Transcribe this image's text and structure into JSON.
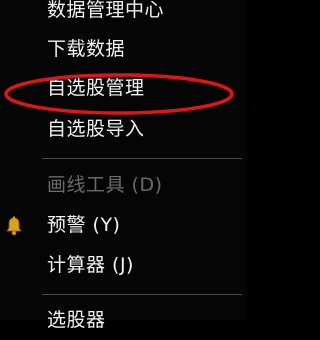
{
  "menu": {
    "items": [
      {
        "label": "数据管理中心"
      },
      {
        "label": "下载数据"
      },
      {
        "label": "自选股管理"
      },
      {
        "label": "自选股导入"
      },
      {
        "label": "画线工具 (D)"
      },
      {
        "label": "预警 (Y)"
      },
      {
        "label": "计算器 (J)"
      },
      {
        "label": "选股器"
      }
    ]
  },
  "colors": {
    "background": "#050505",
    "text": "#f2f2f2",
    "disabled_text": "#6a6a6a",
    "separator": "#4a4a4a",
    "highlight_ellipse": "#e0141a",
    "bell_icon": "#d9a21a"
  },
  "icons": {
    "alert": "bell-icon"
  }
}
